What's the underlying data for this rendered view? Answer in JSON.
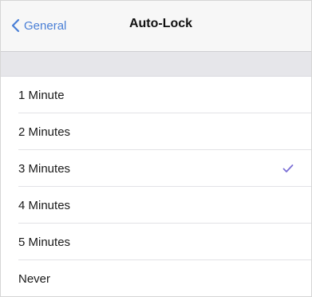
{
  "navbar": {
    "back_label": "General",
    "title": "Auto-Lock"
  },
  "options": [
    {
      "label": "1 Minute",
      "selected": false
    },
    {
      "label": "2 Minutes",
      "selected": false
    },
    {
      "label": "3 Minutes",
      "selected": true
    },
    {
      "label": "4 Minutes",
      "selected": false
    },
    {
      "label": "5 Minutes",
      "selected": false
    },
    {
      "label": "Never",
      "selected": false
    }
  ],
  "colors": {
    "accent": "#4a7fd6",
    "checkmark": "#7b6fd6"
  }
}
